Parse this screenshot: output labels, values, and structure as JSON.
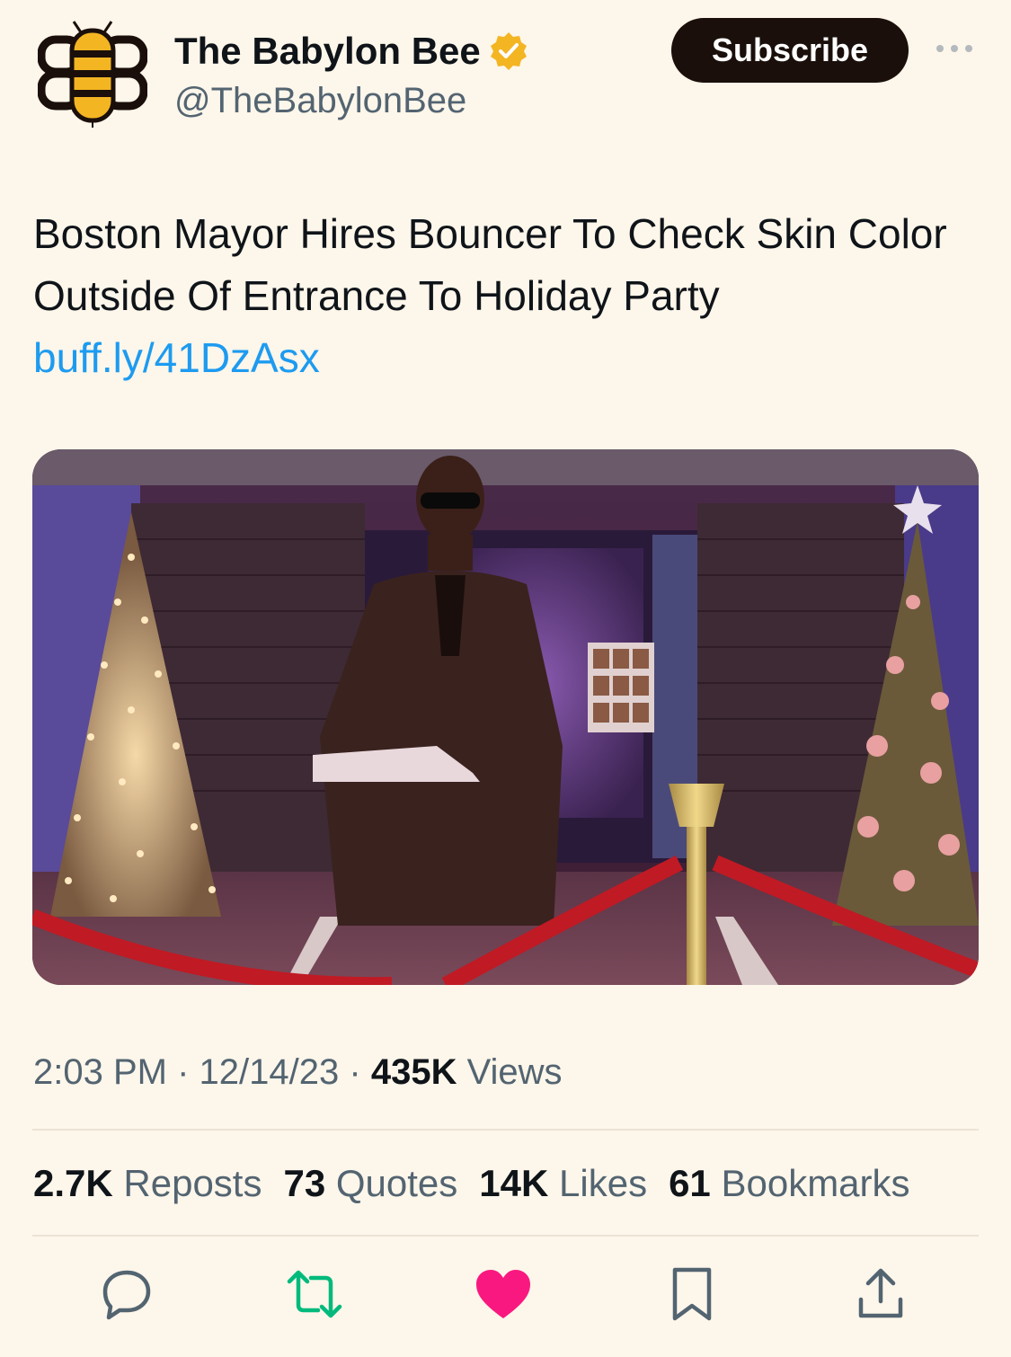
{
  "account": {
    "display_name": "The Babylon Bee",
    "handle": "@TheBabylonBee",
    "verified": true,
    "verified_badge_color": "#f4b523"
  },
  "header": {
    "subscribe_label": "Subscribe",
    "more_icon": "ellipsis-icon"
  },
  "tweet": {
    "text": "Boston Mayor Hires Bouncer To Check Skin Color Outside Of Entrance To Holiday Party",
    "link": "buff.ly/41DzAsx",
    "link_color": "#1d9bf0"
  },
  "meta": {
    "time": "2:03 PM",
    "date": "12/14/23",
    "views_count": "435K",
    "views_label": "Views",
    "separator": "·"
  },
  "stats": [
    {
      "count": "2.7K",
      "label": "Reposts"
    },
    {
      "count": "73",
      "label": "Quotes"
    },
    {
      "count": "14K",
      "label": "Likes"
    },
    {
      "count": "61",
      "label": "Bookmarks"
    }
  ],
  "actions": [
    {
      "icon": "reply-icon",
      "color": "#536471"
    },
    {
      "icon": "repost-icon",
      "color": "#00ba7c"
    },
    {
      "icon": "like-heart-icon",
      "color": "#f91880",
      "active": true
    },
    {
      "icon": "bookmark-icon",
      "color": "#536471"
    },
    {
      "icon": "share-icon",
      "color": "#536471"
    }
  ],
  "colors": {
    "background": "#fdf6ea",
    "subscribe_bg": "#1a0f0a",
    "secondary_text": "#536471"
  }
}
